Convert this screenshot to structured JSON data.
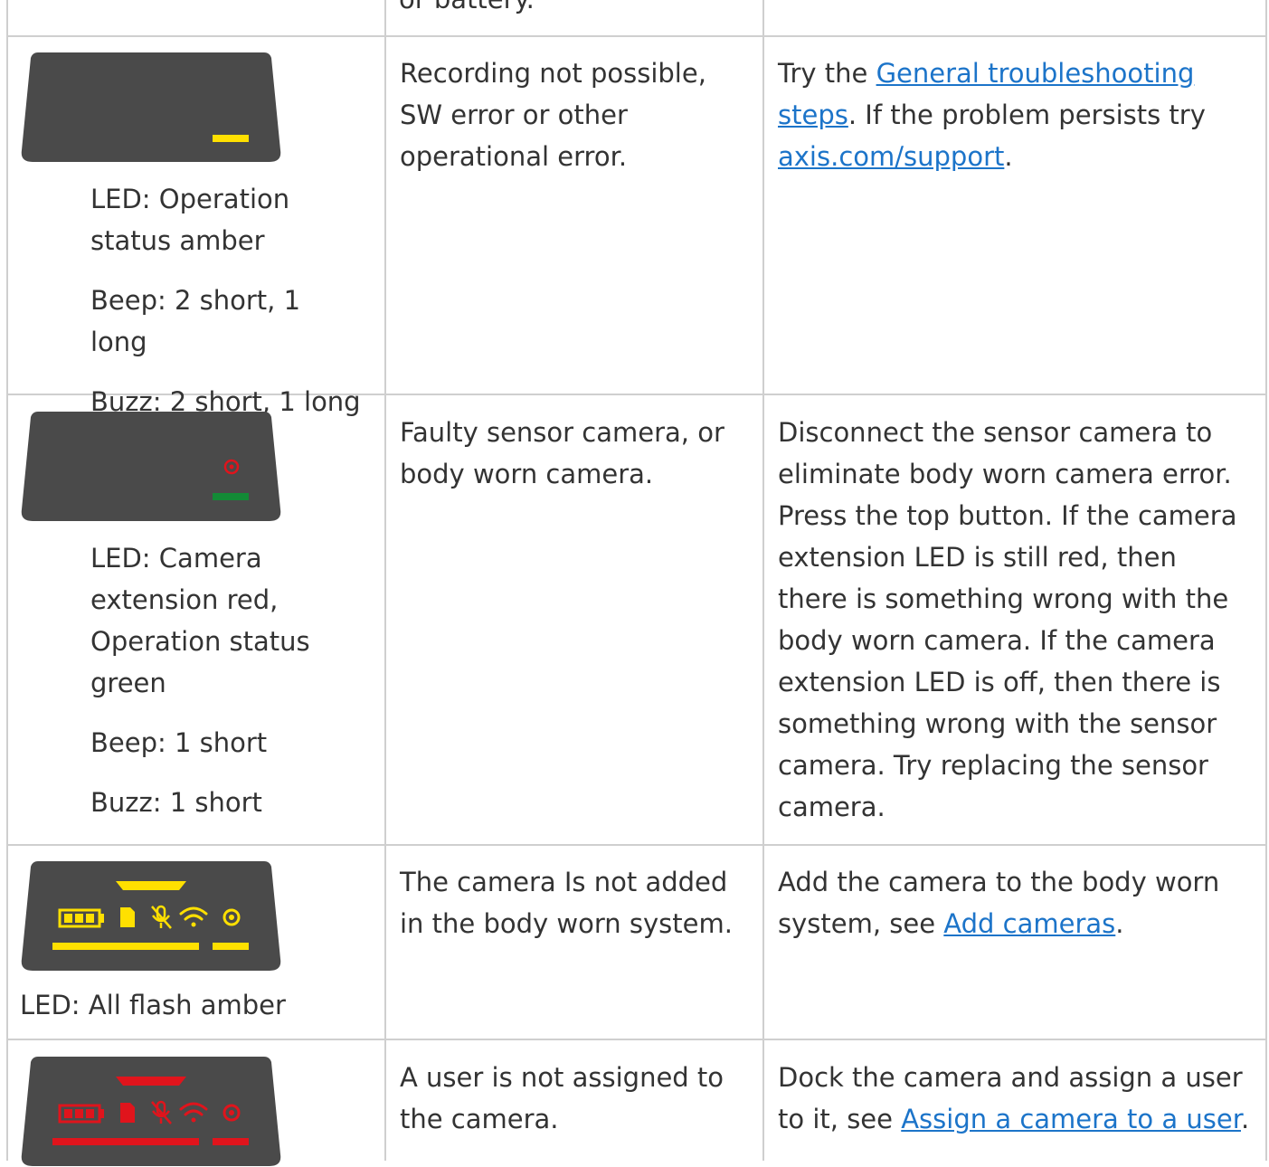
{
  "top_fragment": "or battery.",
  "rows": [
    {
      "device": "amber-operation",
      "led": "LED: Operation status amber",
      "beep": "Beep: 2 short, 1 long",
      "buzz": "Buzz: 2 short, 1 long",
      "cause": "Recording not possible, SW error or other operational error.",
      "solution": {
        "pre": "Try the ",
        "link1": "General troubleshooting steps",
        "mid": ". If the problem persists try ",
        "link2": "axis.com/support",
        "post": "."
      }
    },
    {
      "device": "red-camera-green-operation",
      "led": "LED: Camera extension red, Operation status green",
      "beep": "Beep: 1 short",
      "buzz": "Buzz: 1 short",
      "cause": "Faulty sensor camera, or body worn camera.",
      "solution": {
        "text": "Disconnect the sensor camera to eliminate body worn camera error. Press the top button. If the camera extension LED is still red, then there is something wrong with the body worn camera. If the camera extension LED is off, then there is something wrong with the sensor camera. Try replacing the sensor camera."
      }
    },
    {
      "device": "all-amber",
      "led": "LED: All flash amber",
      "cause": "The camera Is not added in the body worn system.",
      "solution": {
        "pre": "Add the camera to the body worn system, see ",
        "link1": "Add cameras",
        "post": "."
      }
    },
    {
      "device": "all-red",
      "cause": "A user is not assigned to the camera.",
      "solution": {
        "pre": "Dock the camera and assign a user to it, see ",
        "link1": "Assign a camera to a user",
        "post": "."
      }
    }
  ],
  "colors": {
    "device_body": "#4a4a4a",
    "amber": "#ffe000",
    "red": "#e0141c",
    "green": "#138a36",
    "link": "#1c74c9",
    "border": "#cfcfcf"
  }
}
